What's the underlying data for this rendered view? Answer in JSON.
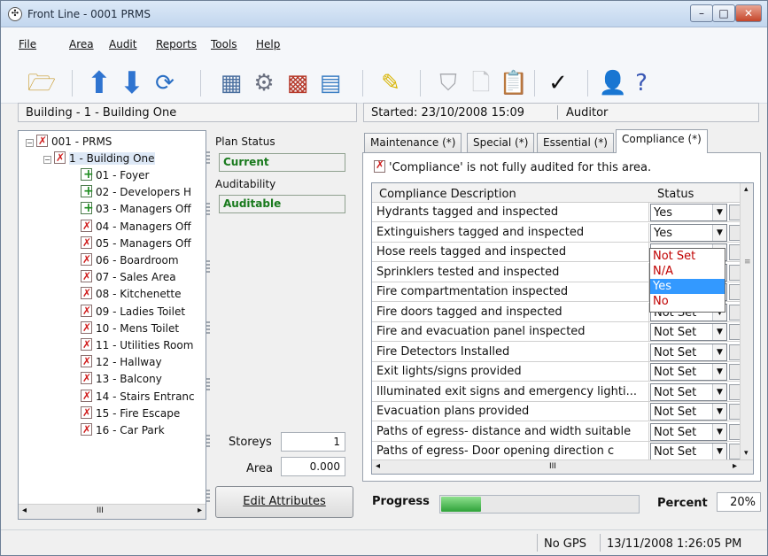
{
  "window": {
    "title": "Front Line - 0001 PRMS"
  },
  "menu": [
    "File",
    "Area",
    "Audit",
    "Reports",
    "Tools",
    "Help"
  ],
  "toolbar_icons": [
    "folder-open-icon",
    "arrow-up-icon",
    "arrow-down-icon",
    "refresh-icon",
    "building-icon",
    "gears-icon",
    "add-wall-icon",
    "add-grid-icon",
    "notes-icon",
    "shield-icon",
    "document-icon",
    "clipboard-icon",
    "checkmark-icon",
    "user-icon",
    "help-icon"
  ],
  "info": {
    "location": "Building - 1 - Building One",
    "started": "Started: 23/10/2008 15:09",
    "auditor": "Auditor"
  },
  "tree": {
    "root": "001 - PRMS",
    "building": "1 - Building One",
    "areas": [
      {
        "label": "01 - Foyer",
        "state": "green"
      },
      {
        "label": "02 - Developers H",
        "state": "green"
      },
      {
        "label": "03 - Managers Off",
        "state": "green"
      },
      {
        "label": "04 - Managers Off",
        "state": "red"
      },
      {
        "label": "05 - Managers Off",
        "state": "red"
      },
      {
        "label": "06 - Boardroom",
        "state": "red"
      },
      {
        "label": "07 - Sales Area",
        "state": "red"
      },
      {
        "label": "08 - Kitchenette",
        "state": "red"
      },
      {
        "label": "09 - Ladies Toilet",
        "state": "red"
      },
      {
        "label": "10 - Mens Toilet",
        "state": "red"
      },
      {
        "label": "11 - Utilities Room",
        "state": "red"
      },
      {
        "label": "12 - Hallway",
        "state": "red"
      },
      {
        "label": "13 - Balcony",
        "state": "red"
      },
      {
        "label": "14 - Stairs Entranc",
        "state": "red"
      },
      {
        "label": "15 - Fire Escape",
        "state": "red"
      },
      {
        "label": "16 - Car Park",
        "state": "red"
      }
    ],
    "scroll_glyph": "III"
  },
  "plan": {
    "status_label": "Plan Status",
    "status_value": "Current",
    "auditability_label": "Auditability",
    "auditability_value": "Auditable",
    "storeys_label": "Storeys",
    "storeys_value": "1",
    "area_label": "Area",
    "area_value": "0.000",
    "edit_button": "Edit Attributes"
  },
  "tabs": [
    "Maintenance (*)",
    "Special (*)",
    "Essential (*)",
    "Compliance (*)"
  ],
  "active_tab": 3,
  "warning": "'Compliance' is not fully audited for this area.",
  "grid": {
    "headers": {
      "description": "Compliance Description",
      "status": "Status"
    },
    "rows": [
      {
        "desc": "Hydrants tagged and inspected",
        "status": "Yes"
      },
      {
        "desc": "Extinguishers tagged and inspected",
        "status": "Yes"
      },
      {
        "desc": "Hose reels tagged and inspected",
        "status": ""
      },
      {
        "desc": "Sprinklers tested and inspected",
        "status": ""
      },
      {
        "desc": "Fire compartmentation inspected",
        "status": ""
      },
      {
        "desc": "Fire doors tagged and inspected",
        "status": "Not Set"
      },
      {
        "desc": "Fire and evacuation panel inspected",
        "status": "Not Set"
      },
      {
        "desc": "Fire Detectors Installed",
        "status": "Not Set"
      },
      {
        "desc": "Exit lights/signs provided",
        "status": "Not Set"
      },
      {
        "desc": "Illuminated exit signs and emergency lighti...",
        "status": "Not Set"
      },
      {
        "desc": "Evacuation plans provided",
        "status": "Not Set"
      },
      {
        "desc": "Paths of egress- distance and width suitable",
        "status": "Not Set"
      },
      {
        "desc": "Paths of egress- Door opening direction c",
        "status": "Not Set"
      }
    ],
    "dropdown_options": [
      "Not Set",
      "N/A",
      "Yes",
      "No"
    ],
    "dropdown_selected": 2,
    "scroll_glyph": "III"
  },
  "progress": {
    "label": "Progress",
    "fraction": 0.2,
    "percent_label": "Percent",
    "percent_value": "20%"
  },
  "statusbar": {
    "gps": "No GPS",
    "time": "13/11/2008 1:26:05 PM"
  }
}
